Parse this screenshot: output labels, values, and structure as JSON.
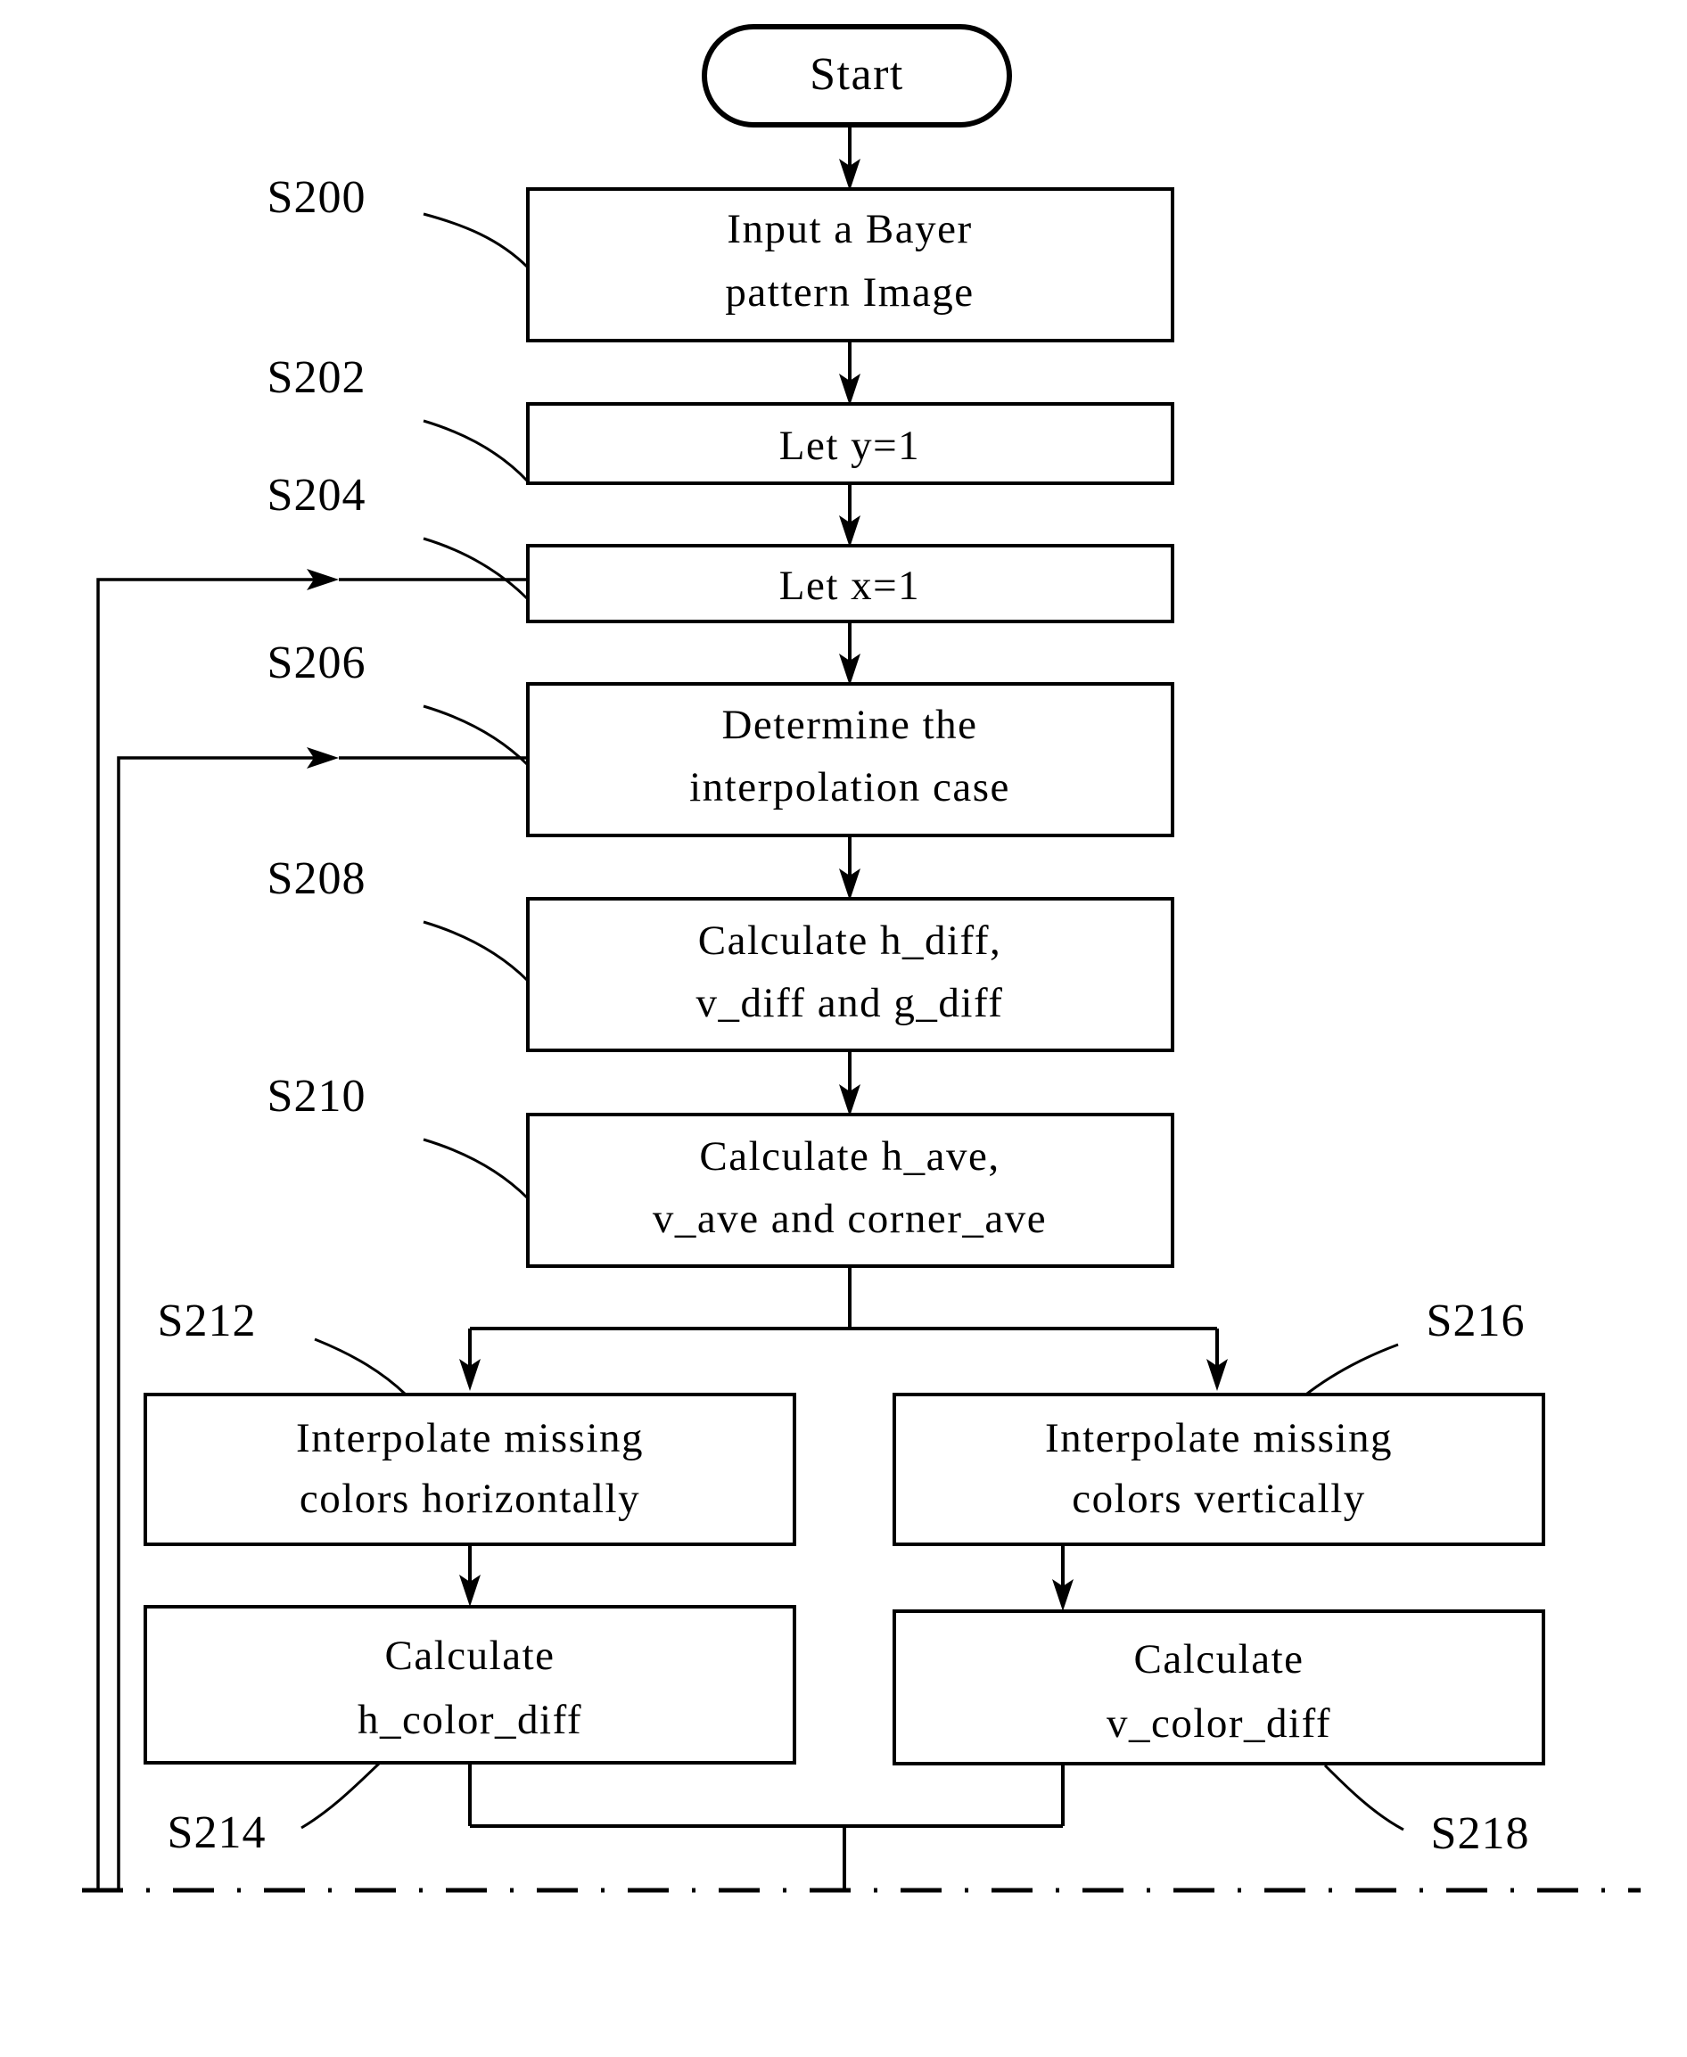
{
  "diagram": {
    "title": "Bayer pattern interpolation flowchart",
    "background_color": "#ffffff",
    "line_color": "#000000"
  },
  "nodes": {
    "start": {
      "label": "Start",
      "shape": "terminator"
    },
    "s200": {
      "step": "S200",
      "line1": "Input a Bayer",
      "line2": "pattern Image"
    },
    "s202": {
      "step": "S202",
      "line1": "Let  y=1",
      "line2": ""
    },
    "s204": {
      "step": "S204",
      "line1": "Let  x=1",
      "line2": ""
    },
    "s206": {
      "step": "S206",
      "line1": "Determine the",
      "line2": "interpolation case"
    },
    "s208": {
      "step": "S208",
      "line1": "Calculate h_diff,",
      "line2": "v_diff and g_diff"
    },
    "s210": {
      "step": "S210",
      "line1": "Calculate h_ave,",
      "line2": "v_ave and corner_ave"
    },
    "s212": {
      "step": "S212",
      "line1": "Interpolate missing",
      "line2": "colors horizontally"
    },
    "s214": {
      "step": "S214",
      "line1": "Calculate",
      "line2": "h_color_diff"
    },
    "s216": {
      "step": "S216",
      "line1": "Interpolate missing",
      "line2": "colors vertically"
    },
    "s218": {
      "step": "S218",
      "line1": "Calculate",
      "line2": "v_color_diff"
    }
  },
  "connectors": {
    "start_to_s200": "down-arrow",
    "s200_to_s202": "down-arrow",
    "s202_to_s204": "down-arrow",
    "s204_to_s206": "down-arrow",
    "s206_to_s208": "down-arrow",
    "s208_to_s210": "down-arrow",
    "s210_split": "branch-to-s212-and-s216",
    "s212_to_s214": "down-arrow",
    "s216_to_s218": "down-arrow",
    "merge_to_bottom": "join-down",
    "feedback_outer": "loop-back-to-s204",
    "feedback_inner": "loop-back-to-s206",
    "page_break": "dash-dot-cut-line"
  }
}
